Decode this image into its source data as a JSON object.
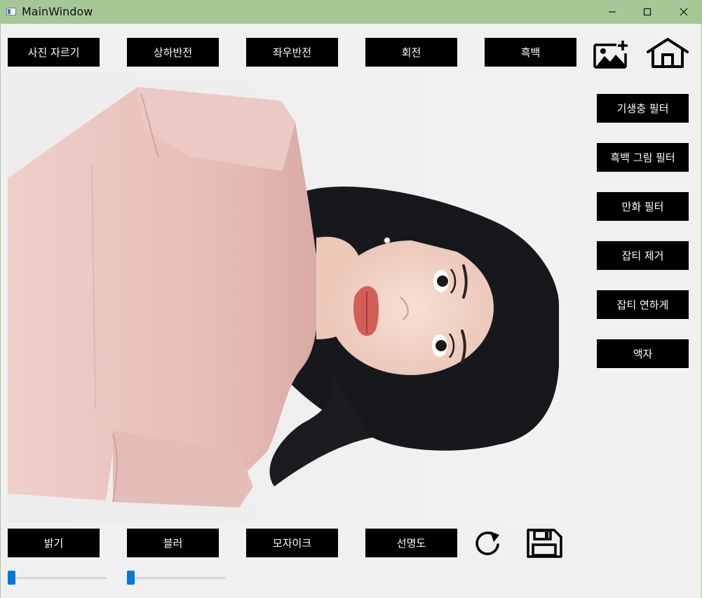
{
  "window": {
    "title": "MainWindow",
    "minimize_icon": "minimize-icon",
    "maximize_icon": "maximize-icon",
    "close_icon": "close-icon",
    "title_bar_color": "#a5c796"
  },
  "toolbar": {
    "crop_label": "사진 자르기",
    "flip_vertical_label": "상하반전",
    "flip_horizontal_label": "좌우반전",
    "rotate_label": "회전",
    "grayscale_label": "흑백",
    "open_image_icon": "add-image-icon",
    "home_icon": "home-icon"
  },
  "filters": {
    "parasite_filter_label": "기생충 필터",
    "bw_drawing_filter_label": "흑백 그림 필터",
    "cartoon_filter_label": "만화 필터",
    "noise_removal_label": "잡티 제거",
    "noise_soften_label": "잡티 연하게",
    "frame_label": "액자"
  },
  "bottom": {
    "brightness_label": "밝기",
    "blur_label": "블러",
    "mosaic_label": "모자이크",
    "sharpness_label": "선명도",
    "reset_icon": "refresh-icon",
    "save_icon": "save-icon"
  },
  "sliders": {
    "brightness_value": 0,
    "blur_value": 0,
    "accent_color": "#0078d7"
  },
  "image": {
    "subject": "photo-portrait-rotated"
  }
}
